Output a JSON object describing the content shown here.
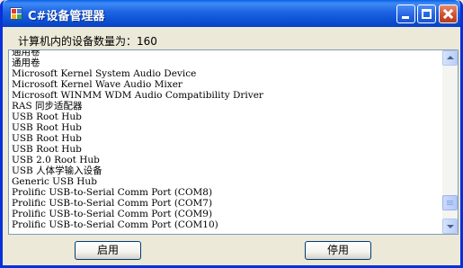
{
  "window": {
    "title": "C#设备管理器",
    "icon": "app-window-icon"
  },
  "titlebar_buttons": [
    {
      "name": "minimize",
      "icon": "minimize-icon"
    },
    {
      "name": "maximize",
      "icon": "maximize-icon"
    },
    {
      "name": "close",
      "icon": "close-icon"
    }
  ],
  "device_count": {
    "text": "计算机内的设备数量为：160"
  },
  "device_list": {
    "items": [
      "通用卷",
      "通用卷",
      "Microsoft Kernel System Audio Device",
      "Microsoft Kernel Wave Audio Mixer",
      "Microsoft WINMM WDM Audio Compatibility Driver",
      "RAS 同步适配器",
      "USB Root Hub",
      "USB Root Hub",
      "USB Root Hub",
      "USB Root Hub",
      "USB 2.0 Root Hub",
      "USB 人体学输入设备",
      "Generic USB Hub",
      "Prolific USB-to-Serial Comm Port (COM8)",
      "Prolific USB-to-Serial Comm Port (COM7)",
      "Prolific USB-to-Serial Comm Port (COM9)",
      "Prolific USB-to-Serial Comm Port (COM10)"
    ],
    "scroll_position": 0.94
  },
  "buttons": {
    "enable": "启用",
    "disable": "停用"
  },
  "colors": {
    "titlebar": "#0a4fd2",
    "window_border": "#0831d9",
    "face": "#ece9d8",
    "button_border": "#003c74"
  }
}
